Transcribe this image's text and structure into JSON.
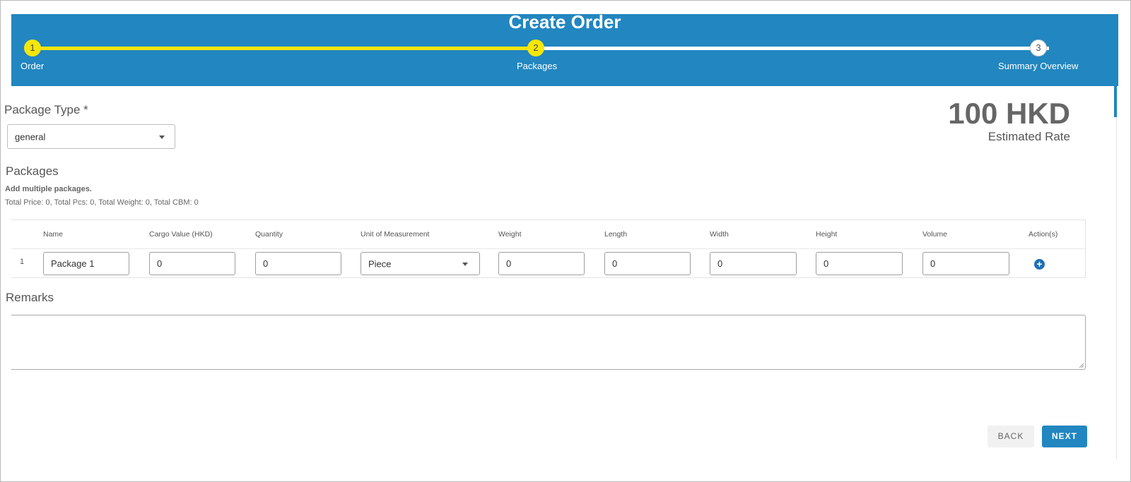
{
  "header": {
    "title": "Create Order",
    "steps": [
      {
        "number": "1",
        "label": "Order"
      },
      {
        "number": "2",
        "label": "Packages"
      },
      {
        "number": "3",
        "label": "Summary Overview"
      }
    ]
  },
  "package_type": {
    "label": "Package Type *",
    "value": "general"
  },
  "rate": {
    "amount": "100 HKD",
    "label": "Estimated Rate"
  },
  "packages": {
    "title": "Packages",
    "hint": "Add multiple packages.",
    "totals": "Total Price: 0, Total Pcs: 0, Total Weight: 0, Total CBM: 0",
    "columns": [
      "Name",
      "Cargo Value (HKD)",
      "Quantity",
      "Unit of Measurement",
      "Weight",
      "Length",
      "Width",
      "Height",
      "Volume",
      "Action(s)"
    ],
    "rows": [
      {
        "index": "1",
        "name": "Package 1",
        "cargo_value": "0",
        "quantity": "0",
        "unit": "Piece",
        "weight": "0",
        "length": "0",
        "width": "0",
        "height": "0",
        "volume": "0"
      }
    ]
  },
  "remarks": {
    "label": "Remarks",
    "value": ""
  },
  "buttons": {
    "back": "BACK",
    "next": "NEXT"
  },
  "colors": {
    "header": "#2286c0",
    "active_step": "#f5e60b",
    "primary": "#2286c0"
  },
  "icons": {
    "add": "plus-circle-icon",
    "dropdown": "caret-down-icon"
  }
}
